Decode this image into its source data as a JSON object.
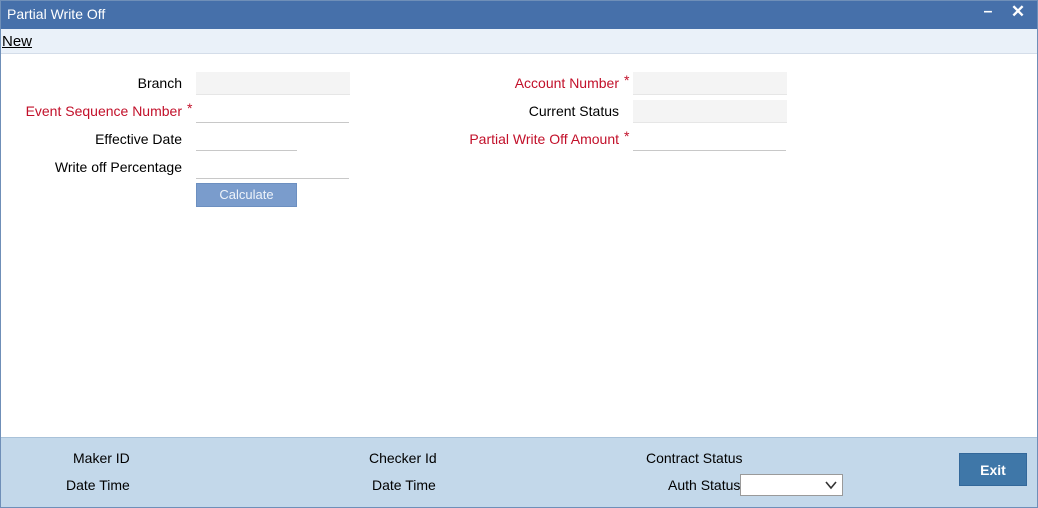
{
  "window": {
    "title": "Partial Write Off",
    "minimize_symbol": "–",
    "close_symbol": "✕"
  },
  "menu": {
    "new_label": "New"
  },
  "form": {
    "branch_label": "Branch",
    "branch_value": "",
    "event_seq_label": "Event Sequence Number",
    "event_seq_value": "",
    "effective_date_label": "Effective Date",
    "effective_date_value": "",
    "write_off_pct_label": "Write off Percentage",
    "write_off_pct_value": "",
    "calculate_label": "Calculate",
    "account_number_label": "Account Number",
    "account_number_value": "",
    "current_status_label": "Current Status",
    "current_status_value": "",
    "pwo_amount_label": "Partial Write Off Amount",
    "pwo_amount_value": "",
    "required_marker": "*"
  },
  "footer": {
    "maker_id_label": "Maker ID",
    "maker_date_time_label": "Date Time",
    "checker_id_label": "Checker Id",
    "checker_date_time_label": "Date Time",
    "contract_status_label": "Contract Status",
    "auth_status_label": "Auth Status",
    "auth_status_value": "",
    "exit_label": "Exit"
  },
  "colors": {
    "titlebar": "#4670aa",
    "required": "#c2102a",
    "footer": "#c3d8ea",
    "exit_button": "#3f77a8"
  }
}
